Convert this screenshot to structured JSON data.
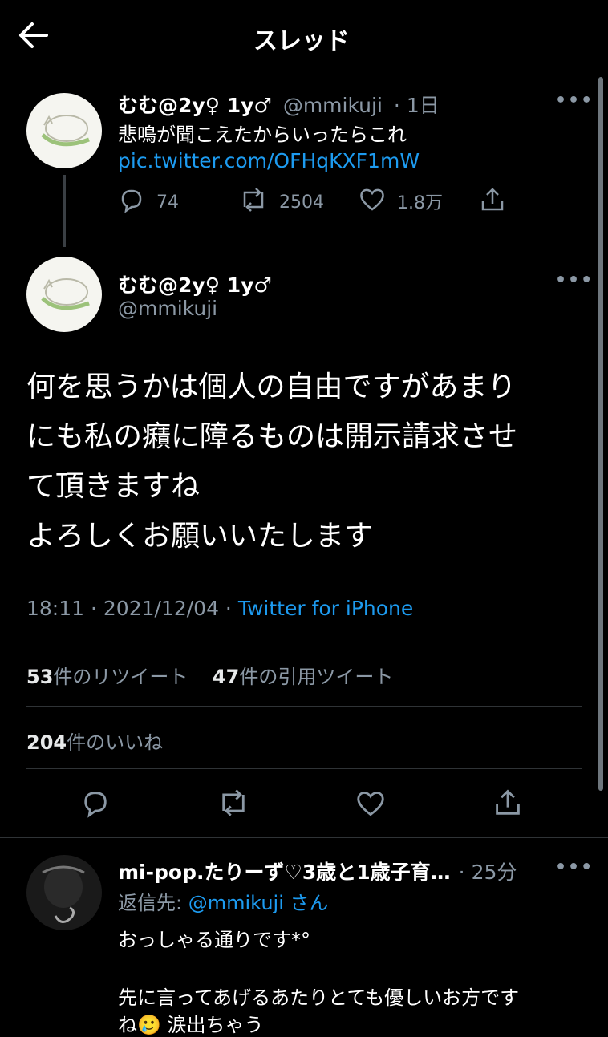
{
  "header": {
    "title": "スレッド"
  },
  "parent_tweet": {
    "name": "むむ@2y♀ 1y♂",
    "handle": "@mmikuji",
    "time": "· 1日",
    "text": "悲鳴が聞こえたからいったらこれ",
    "link": "pic.twitter.com/OFHqKXF1mW",
    "replies": "74",
    "retweets": "2504",
    "likes": "1.8万"
  },
  "main_tweet": {
    "name": "むむ@2y♀ 1y♂",
    "handle": "@mmikuji",
    "lines": [
      "何を思うかは個人の自由ですがあまり",
      "にも私の癪に障るものは開示請求させ",
      "て頂きますね",
      "よろしくお願いいたします"
    ],
    "timestamp": "18:11 · 2021/12/04 ·",
    "source": "Twitter for iPhone",
    "retweet_count": "53",
    "retweet_label": "件のリツイート",
    "quote_count": "47",
    "quote_label": "件の引用ツイート",
    "like_count": "204",
    "like_label": "件のいいね"
  },
  "reply_tweet": {
    "name": "mi-pop.たりーず♡3歳と1歳子育…",
    "time": "· 25分",
    "reply_prefix": "返信先:",
    "reply_to": "@mmikuji",
    "reply_suffix": "さん",
    "line1": "おっしゃる通りです*°",
    "line2": "先に言ってあげるあたりとても優しいお方です",
    "line3": "ね🥲 涙出ちゃう"
  },
  "icons": {
    "back": "back-arrow-icon",
    "more": "more-icon",
    "reply": "reply-icon",
    "retweet": "retweet-icon",
    "like": "like-icon",
    "share": "share-icon"
  }
}
